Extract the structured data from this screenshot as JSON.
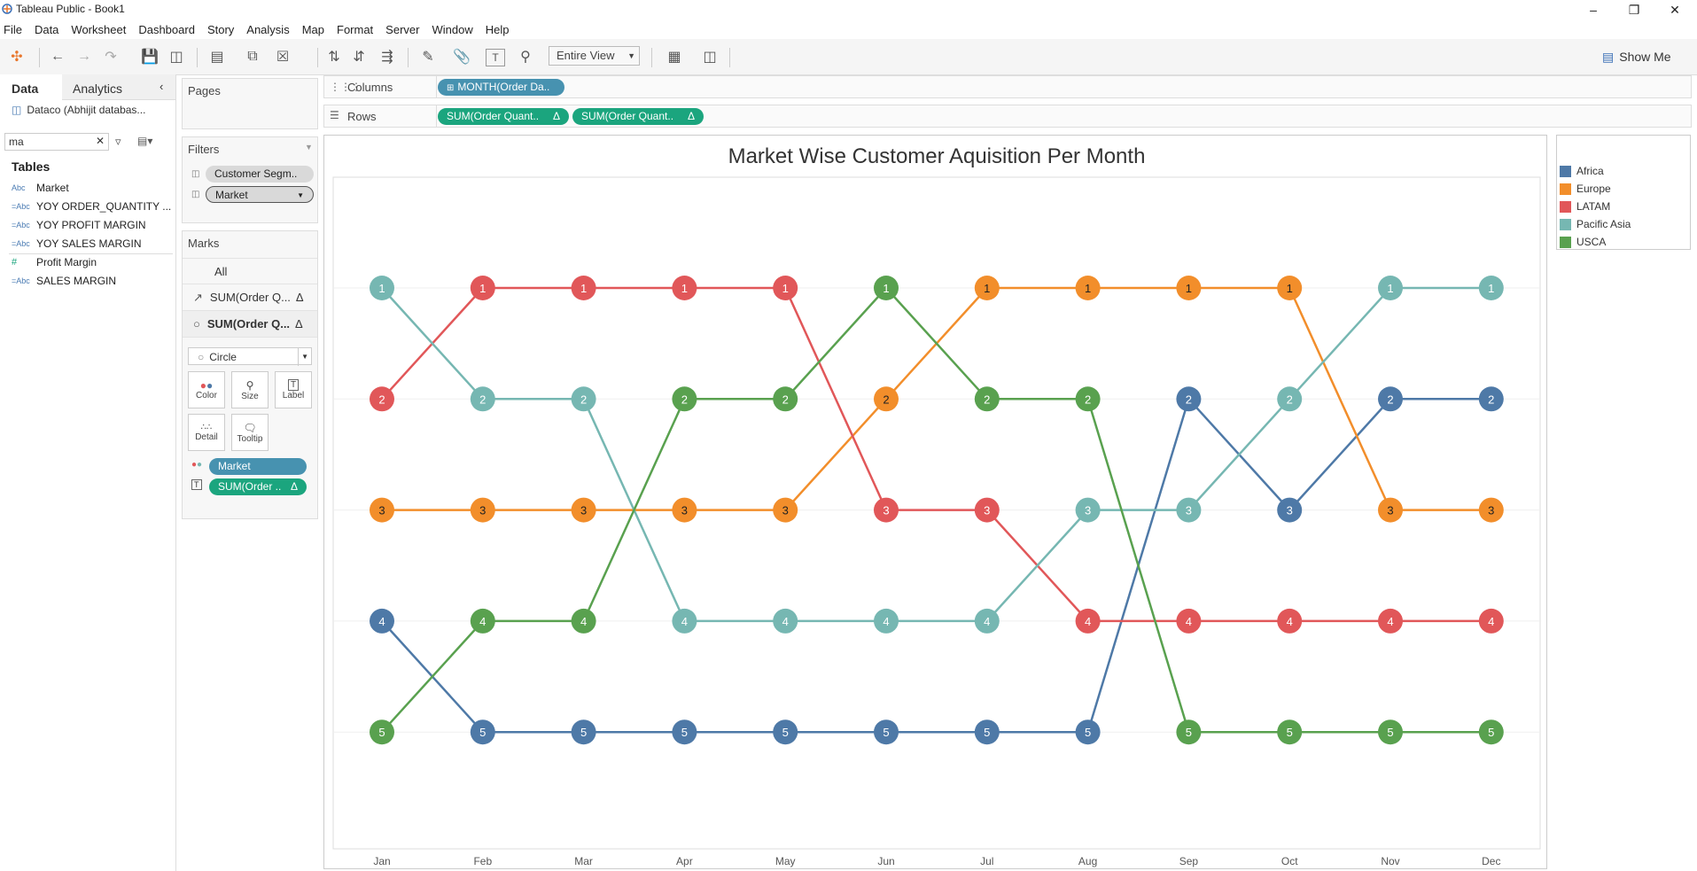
{
  "window": {
    "title": "Tableau Public - Book1"
  },
  "menu": [
    "File",
    "Data",
    "Worksheet",
    "Dashboard",
    "Story",
    "Analysis",
    "Map",
    "Format",
    "Server",
    "Window",
    "Help"
  ],
  "toolbar": {
    "view_mode": "Entire View",
    "show_me": "Show Me"
  },
  "data_pane": {
    "tab_data": "Data",
    "tab_analytics": "Analytics",
    "datasource": "Dataco (Abhijit databas...",
    "search_value": "ma",
    "tables_heading": "Tables",
    "fields": [
      {
        "type": "Abc",
        "name": "Market"
      },
      {
        "type": "=Abc",
        "name": "YOY ORDER_QUANTITY ..."
      },
      {
        "type": "=Abc",
        "name": "YOY PROFIT MARGIN"
      },
      {
        "type": "=Abc",
        "name": "YOY SALES MARGIN"
      },
      {
        "type": "#",
        "name": "Profit Margin"
      },
      {
        "type": "=Abc",
        "name": "SALES MARGIN"
      }
    ]
  },
  "pages": {
    "title": "Pages"
  },
  "filters": {
    "title": "Filters",
    "items": [
      "Customer Segm..",
      "Market"
    ]
  },
  "marks": {
    "title": "Marks",
    "all": "All",
    "layer1": "SUM(Order Q...",
    "layer2": "SUM(Order Q...",
    "mark_type": "Circle",
    "buttons": [
      "Color",
      "Size",
      "Label",
      "Detail",
      "Tooltip"
    ],
    "pill_color": "Market",
    "pill_label": "SUM(Order ..",
    "delta": "Δ"
  },
  "shelves": {
    "columns_label": "Columns",
    "rows_label": "Rows",
    "columns_pill": "MONTH(Order Da..",
    "rows_pills": [
      "SUM(Order Quant..",
      "SUM(Order Quant.."
    ]
  },
  "legend": {
    "items": [
      {
        "name": "Africa",
        "color": "#4e79a7"
      },
      {
        "name": "Europe",
        "color": "#f28e2b"
      },
      {
        "name": "LATAM",
        "color": "#e15759"
      },
      {
        "name": "Pacific Asia",
        "color": "#76b7b2"
      },
      {
        "name": "USCA",
        "color": "#59a14f"
      }
    ]
  },
  "chart_data": {
    "type": "line",
    "title": "Market Wise Customer Aquisition Per Month",
    "x": [
      "Jan",
      "Feb",
      "Mar",
      "Apr",
      "May",
      "Jun",
      "Jul",
      "Aug",
      "Sep",
      "Oct",
      "Nov",
      "Dec"
    ],
    "y_reversed": true,
    "ylim": [
      1,
      5
    ],
    "series": [
      {
        "name": "Africa",
        "color": "#4e79a7",
        "values": [
          4,
          5,
          5,
          5,
          5,
          5,
          5,
          5,
          2,
          3,
          2,
          2
        ]
      },
      {
        "name": "Europe",
        "color": "#f28e2b",
        "values": [
          3,
          3,
          3,
          3,
          3,
          2,
          1,
          1,
          1,
          1,
          3,
          3
        ]
      },
      {
        "name": "LATAM",
        "color": "#e15759",
        "values": [
          2,
          1,
          1,
          1,
          1,
          3,
          3,
          4,
          4,
          4,
          4,
          4
        ]
      },
      {
        "name": "Pacific Asia",
        "color": "#76b7b2",
        "values": [
          1,
          2,
          2,
          4,
          4,
          4,
          4,
          3,
          3,
          2,
          1,
          1
        ]
      },
      {
        "name": "USCA",
        "color": "#59a14f",
        "values": [
          5,
          4,
          4,
          2,
          2,
          1,
          2,
          2,
          5,
          5,
          5,
          5
        ]
      }
    ]
  }
}
